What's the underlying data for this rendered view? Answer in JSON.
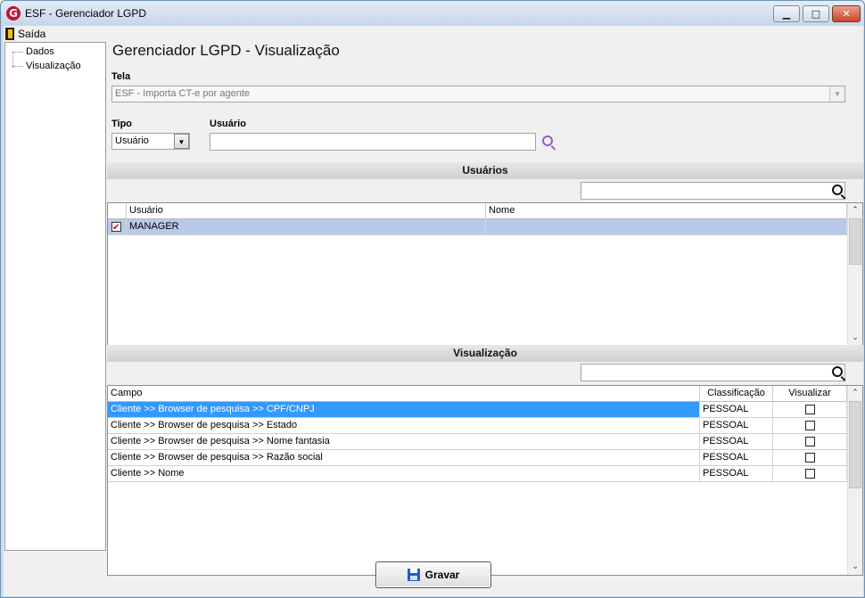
{
  "window": {
    "title": "ESF - Gerenciador LGPD",
    "logo_letter": "G",
    "minimize_glyph": "▁",
    "maximize_glyph": "□",
    "close_glyph": "✕"
  },
  "menu": {
    "exit_label": "Saída",
    "exit_icon": "door-exit-icon"
  },
  "nav": {
    "items": [
      {
        "label": "Dados"
      },
      {
        "label": "Visualização"
      }
    ]
  },
  "page": {
    "title": "Gerenciador LGPD - Visualização"
  },
  "tela": {
    "label": "Tela",
    "value": "ESF - Importa CT-e por agente"
  },
  "tipo": {
    "label": "Tipo",
    "value": "Usuário",
    "options_visible": [
      "Usuário"
    ]
  },
  "usuario_filter": {
    "label": "Usuário",
    "value": ""
  },
  "usuarios_section": {
    "title": "Usuários",
    "search_value": "",
    "columns": [
      "Usuário",
      "Nome"
    ],
    "rows": [
      {
        "checked": true,
        "usuario": "MANAGER",
        "nome": ""
      }
    ]
  },
  "visualizacao_section": {
    "title": "Visualização",
    "search_value": "",
    "columns": [
      "Campo",
      "Classificação",
      "Visualizar"
    ],
    "rows": [
      {
        "campo": "Cliente >> Browser de pesquisa >> CPF/CNPJ",
        "classificacao": "PESSOAL",
        "visualizar": false
      },
      {
        "campo": "Cliente >> Browser de pesquisa >> Estado",
        "classificacao": "PESSOAL",
        "visualizar": false
      },
      {
        "campo": "Cliente >> Browser de pesquisa >> Nome fantasia",
        "classificacao": "PESSOAL",
        "visualizar": false
      },
      {
        "campo": "Cliente >> Browser de pesquisa >> Razão social",
        "classificacao": "PESSOAL",
        "visualizar": false
      },
      {
        "campo": "Cliente >> Nome",
        "classificacao": "PESSOAL",
        "visualizar": false
      }
    ]
  },
  "actions": {
    "save_label": "Gravar"
  },
  "colors": {
    "selection": "#3399ff",
    "selection_light": "#b9c9ea",
    "accent_logo": "#c8102e"
  }
}
